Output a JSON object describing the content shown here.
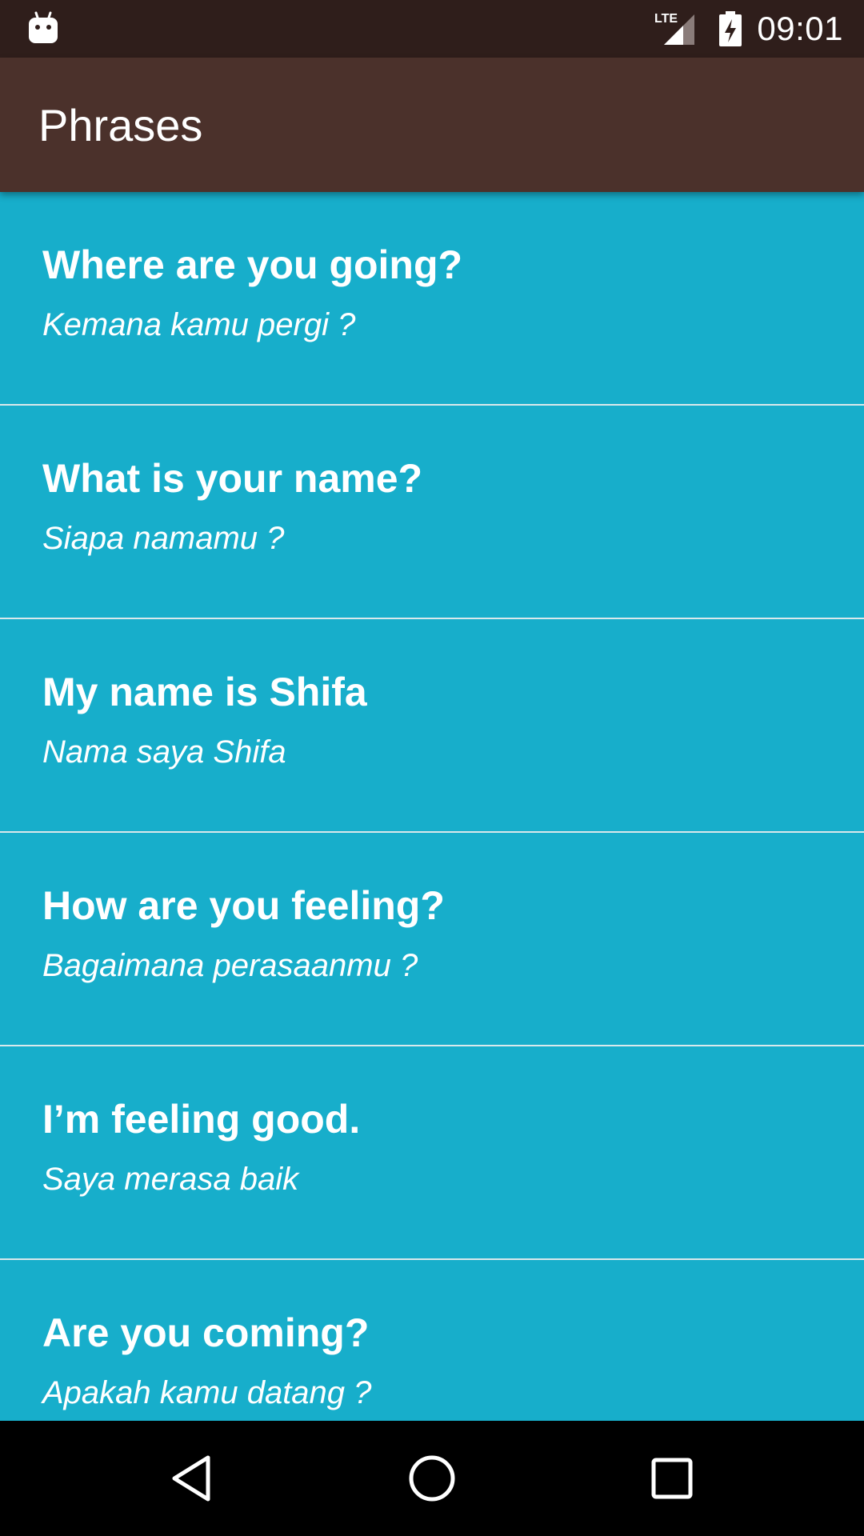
{
  "status_bar": {
    "time": "09:01",
    "network_label": "LTE",
    "icons": [
      "android-notification-icon",
      "lte-signal-icon",
      "battery-charging-icon"
    ]
  },
  "app_bar": {
    "title": "Phrases",
    "color": "#4B312B"
  },
  "theme": {
    "list_background": "#17AECB",
    "status_bar_color": "#2F1E1B",
    "divider_color": "#D9E9EC"
  },
  "phrases": [
    {
      "english": "Where are you going?",
      "translation": "Kemana kamu pergi ?"
    },
    {
      "english": "What is your name?",
      "translation": "Siapa namamu ?"
    },
    {
      "english": "My name is Shifa",
      "translation": "Nama saya Shifa"
    },
    {
      "english": "How are you feeling?",
      "translation": "Bagaimana perasaanmu ?"
    },
    {
      "english": "I’m feeling good.",
      "translation": "Saya merasa baik"
    },
    {
      "english": "Are you coming?",
      "translation": "Apakah kamu datang ?"
    }
  ],
  "nav_bar": {
    "buttons": [
      "back-icon",
      "home-icon",
      "recents-icon"
    ]
  }
}
